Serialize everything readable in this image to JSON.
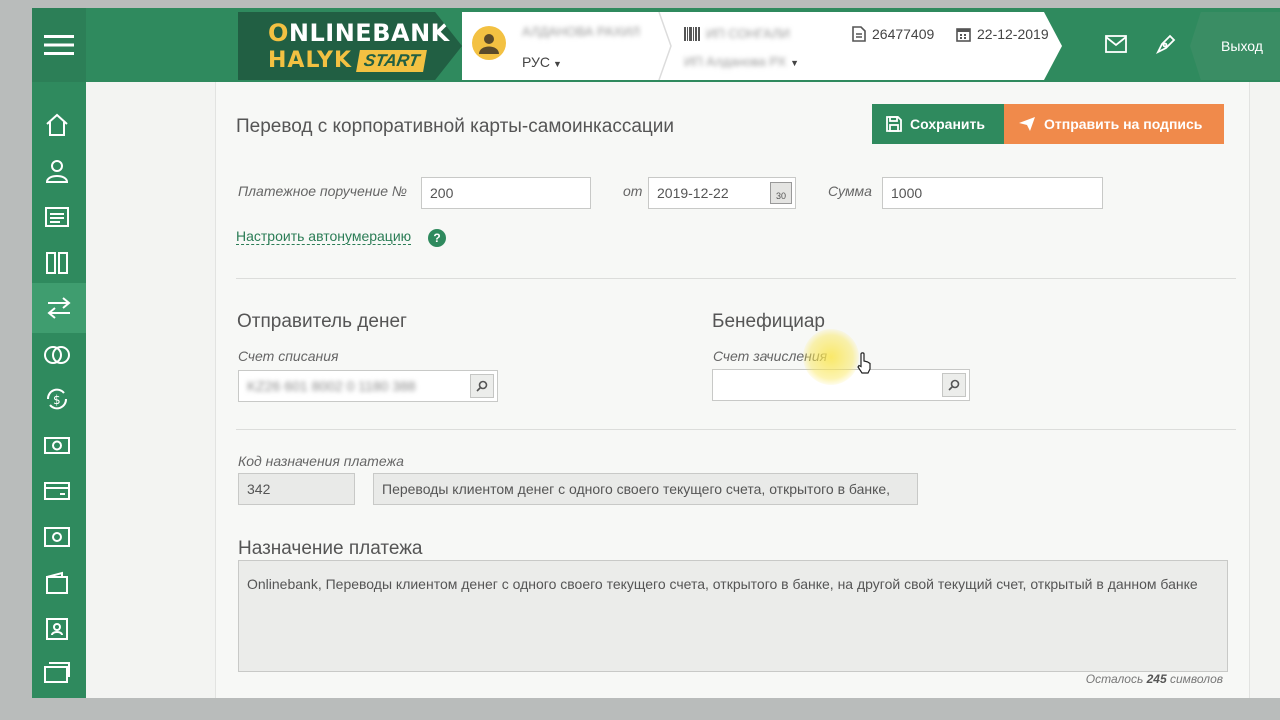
{
  "header": {
    "logo_line1_o": "O",
    "logo_line1_rest": "NLINEBANK",
    "logo_halyk": "HALYK",
    "logo_start": "START",
    "user_name": "АЛДАНОВА РАХИЛ",
    "language": "РУС",
    "company_name": "ИП СОНГАЛИ",
    "company_sub": "ИП Алданова РХ",
    "client_id": "26477409",
    "date": "22-12-2019",
    "exit_label": "Выход"
  },
  "page": {
    "title": "Перевод с корпоративной карты-самоинкассации",
    "save_label": "Сохранить",
    "send_label": "Отправить на подпись"
  },
  "form": {
    "payment_order_label": "Платежное поручение №",
    "payment_order_value": "200",
    "from_label": "от",
    "date_value": "2019-12-22",
    "calendar_day": "30",
    "amount_label": "Сумма",
    "amount_value": "1000",
    "autonumber_link": "Настроить автонумерацию",
    "help_glyph": "?",
    "sender_title": "Отправитель денег",
    "debit_account_label": "Счет списания",
    "debit_account_value": "KZ26 601 8002 0 1180 388",
    "beneficiary_title": "Бенефициар",
    "credit_account_label": "Счет зачисления",
    "credit_account_value": "",
    "purpose_code_label": "Код назначения платежа",
    "purpose_code_value": "342",
    "purpose_code_desc": "Переводы клиентом денег с одного своего текущего счета, открытого в банке,",
    "purpose_title": "Назначение платежа",
    "purpose_text": "Onlinebank, Переводы клиентом денег с одного своего текущего счета, открытого в банке, на другой свой текущий счет, открытый в данном банке",
    "remaining_prefix": "Осталось",
    "remaining_count": "245",
    "remaining_suffix": "символов"
  },
  "colors": {
    "brand_green": "#2f8a5e",
    "brand_dark_green": "#215f43",
    "brand_yellow": "#f3c142",
    "accent_orange": "#f08a4b"
  },
  "icons": [
    "menu-icon",
    "home-icon",
    "user-icon",
    "document-icon",
    "columns-icon",
    "transfer-icon",
    "coins-icon",
    "currency-exchange-icon",
    "cash-icon",
    "card-icon",
    "safe-icon",
    "wallet-icon",
    "id-card-icon",
    "cards-icon",
    "mail-icon",
    "pen-icon",
    "barcode-icon",
    "file-icon",
    "calendar-icon",
    "search-icon",
    "save-icon",
    "send-icon"
  ]
}
